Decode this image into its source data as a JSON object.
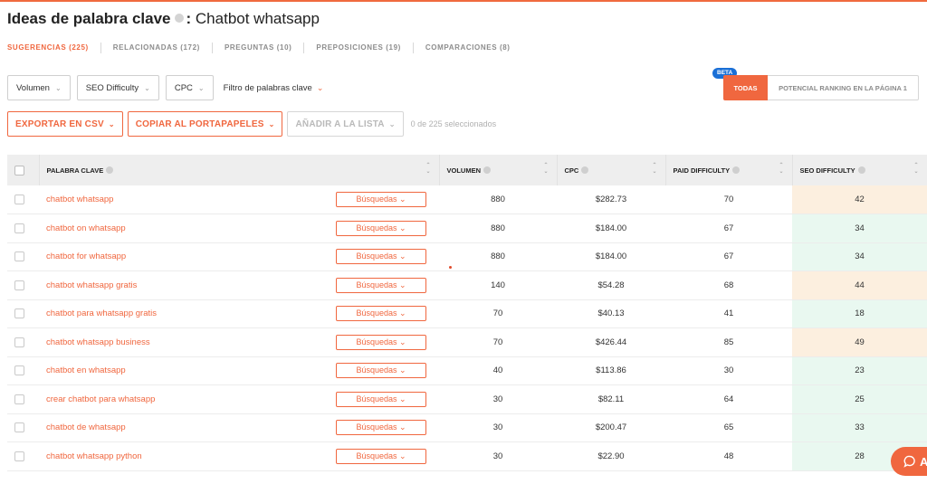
{
  "header": {
    "title_bold": "Ideas de palabra clave",
    "title_sep": ":",
    "keyword": "Chatbot whatsapp"
  },
  "tabs": [
    {
      "label": "SUGERENCIAS (225)",
      "active": true
    },
    {
      "label": "RELACIONADAS (172)"
    },
    {
      "label": "PREGUNTAS (10)"
    },
    {
      "label": "PREPOSICIONES (19)"
    },
    {
      "label": "COMPARACIONES (8)"
    }
  ],
  "filters": {
    "volumen": "Volumen",
    "seo_difficulty": "SEO Difficulty",
    "cpc": "CPC",
    "keyword_filter": "Filtro de palabras clave"
  },
  "toggle": {
    "beta": "BETA",
    "all": "TODAS",
    "ranking": "POTENCIAL RANKING EN LA PÁGINA 1"
  },
  "actions": {
    "export": "EXPORTAR EN CSV",
    "copy": "COPIAR AL PORTAPAPELES",
    "add": "AÑADIR A LA LISTA",
    "selected": "0 de 225 seleccionados"
  },
  "table": {
    "headers": {
      "keyword": "PALABRA CLAVE",
      "volume": "VOLUMEN",
      "cpc": "CPC",
      "paid": "PAID DIFFICULTY",
      "seo": "SEO DIFFICULTY"
    },
    "search_label": "Búsquedas",
    "rows": [
      {
        "keyword": "chatbot whatsapp",
        "volume": "880",
        "cpc": "$282.73",
        "paid": "70",
        "seo": "42",
        "seo_color": "#fcefdf"
      },
      {
        "keyword": "chatbot on whatsapp",
        "volume": "880",
        "cpc": "$184.00",
        "paid": "67",
        "seo": "34",
        "seo_color": "#e9f8f0"
      },
      {
        "keyword": "chatbot for whatsapp",
        "volume": "880",
        "cpc": "$184.00",
        "paid": "67",
        "seo": "34",
        "seo_color": "#e9f8f0"
      },
      {
        "keyword": "chatbot whatsapp gratis",
        "volume": "140",
        "cpc": "$54.28",
        "paid": "68",
        "seo": "44",
        "seo_color": "#fcefdf"
      },
      {
        "keyword": "chatbot para whatsapp gratis",
        "volume": "70",
        "cpc": "$40.13",
        "paid": "41",
        "seo": "18",
        "seo_color": "#e9f8f0"
      },
      {
        "keyword": "chatbot whatsapp business",
        "volume": "70",
        "cpc": "$426.44",
        "paid": "85",
        "seo": "49",
        "seo_color": "#fcefdf"
      },
      {
        "keyword": "chatbot en whatsapp",
        "volume": "40",
        "cpc": "$113.86",
        "paid": "30",
        "seo": "23",
        "seo_color": "#e9f8f0"
      },
      {
        "keyword": "crear chatbot para whatsapp",
        "volume": "30",
        "cpc": "$82.11",
        "paid": "64",
        "seo": "25",
        "seo_color": "#e9f8f0"
      },
      {
        "keyword": "chatbot de whatsapp",
        "volume": "30",
        "cpc": "$200.47",
        "paid": "65",
        "seo": "33",
        "seo_color": "#e9f8f0"
      },
      {
        "keyword": "chatbot whatsapp python",
        "volume": "30",
        "cpc": "$22.90",
        "paid": "48",
        "seo": "28",
        "seo_color": "#e9f8f0"
      }
    ]
  },
  "chat": {
    "label": "A",
    "icon": "chat-icon"
  },
  "colors": {
    "accent": "#f0673f",
    "beta": "#1a6fd6"
  }
}
